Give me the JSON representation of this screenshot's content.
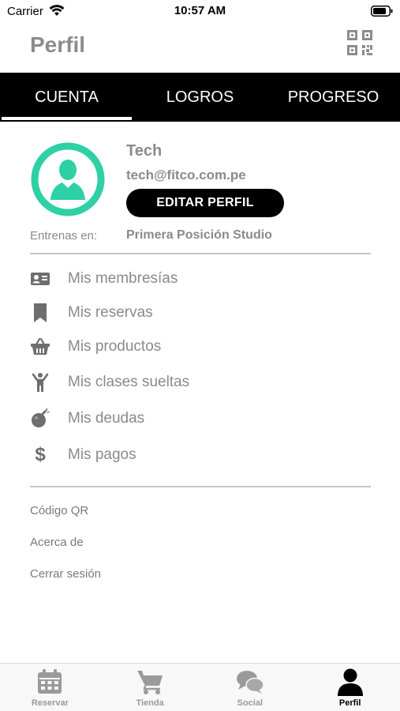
{
  "status_bar": {
    "carrier": "Carrier",
    "time": "10:57 AM"
  },
  "header": {
    "title": "Perfil",
    "qr_icon": "qr-code-icon"
  },
  "tabs": [
    {
      "label": "CUENTA",
      "active": true
    },
    {
      "label": "LOGROS",
      "active": false
    },
    {
      "label": "PROGRESO",
      "active": false
    }
  ],
  "profile": {
    "name": "Tech",
    "email": "tech@fitco.com.pe",
    "edit_button": "EDITAR PERFIL",
    "train_label": "Entrenas en:",
    "train_value": "Primera Posición Studio",
    "avatar_color": "#2ed0a6"
  },
  "menu": [
    {
      "label": "Mis membresías",
      "icon": "id-card-icon"
    },
    {
      "label": "Mis reservas",
      "icon": "bookmark-icon"
    },
    {
      "label": "Mis productos",
      "icon": "basket-icon"
    },
    {
      "label": "Mis clases sueltas",
      "icon": "person-arms-up-icon"
    },
    {
      "label": "Mis deudas",
      "icon": "bomb-icon"
    },
    {
      "label": "Mis pagos",
      "icon": "dollar-icon"
    }
  ],
  "links": [
    {
      "label": "Código QR"
    },
    {
      "label": "Acerca de"
    },
    {
      "label": "Cerrar sesión"
    }
  ],
  "bottom_nav": [
    {
      "label": "Reservar",
      "icon": "calendar-icon",
      "active": false
    },
    {
      "label": "Tienda",
      "icon": "cart-icon",
      "active": false
    },
    {
      "label": "Social",
      "icon": "chat-bubbles-icon",
      "active": false
    },
    {
      "label": "Perfil",
      "icon": "user-icon",
      "active": true
    }
  ],
  "colors": {
    "accent": "#2ed0a6",
    "icon_gray": "#6e6e6e",
    "nav_gray": "#9a9a9a"
  }
}
